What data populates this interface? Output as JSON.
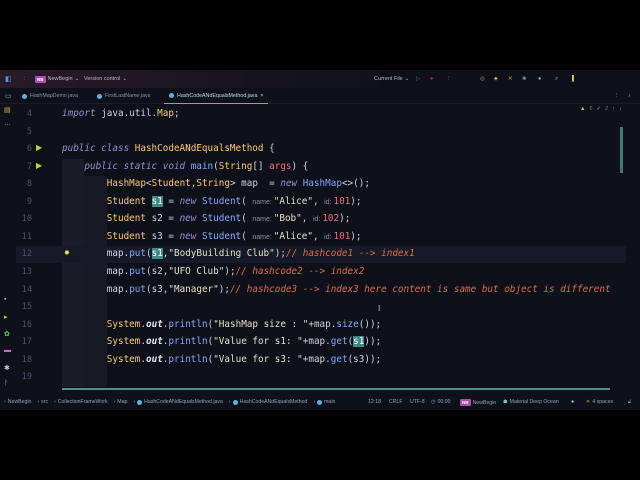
{
  "toolbar": {
    "project": "NewBegin",
    "project_badge": "NB",
    "vcs": "Version control",
    "run_config": "Current File"
  },
  "tabs": [
    {
      "label": "HashMapDemo.java"
    },
    {
      "label": "FirstLastName.java"
    },
    {
      "label": "HashCodeANdEqualsMethod.java",
      "close": "×"
    }
  ],
  "inspections": {
    "warnings": "6",
    "checks": "2"
  },
  "editor": {
    "lines": [
      {
        "n": "4",
        "tokens": [
          [
            "import ",
            "kw"
          ],
          [
            "java.util.",
            "plain"
          ],
          [
            "Map",
            "cls"
          ],
          [
            ";",
            "plain"
          ]
        ]
      },
      {
        "n": "5",
        "tokens": []
      },
      {
        "n": "6",
        "run": true,
        "tokens": [
          [
            "public class ",
            "kw"
          ],
          [
            "HashCodeANdEqualsMethod",
            "cls"
          ],
          [
            " {",
            "plain"
          ]
        ]
      },
      {
        "n": "7",
        "run": true,
        "indent": 1,
        "tokens": [
          [
            "public static void ",
            "kw"
          ],
          [
            "main",
            "fn"
          ],
          [
            "(",
            "plain"
          ],
          [
            "String",
            "cls"
          ],
          [
            "[] ",
            "plain"
          ],
          [
            "args",
            "num"
          ],
          [
            ") {",
            "plain"
          ]
        ]
      },
      {
        "n": "8",
        "indent": 2,
        "tokens": [
          [
            "HashMap",
            "cls"
          ],
          [
            "<",
            "plain"
          ],
          [
            "Student",
            "cls"
          ],
          [
            ",",
            "plain"
          ],
          [
            "String",
            "cls"
          ],
          [
            "> map  = ",
            "plain"
          ],
          [
            "new ",
            "kw"
          ],
          [
            "HashMap",
            "fn"
          ],
          [
            "<>();",
            "plain"
          ]
        ]
      },
      {
        "n": "9",
        "indent": 2,
        "tokens": [
          [
            "Student ",
            "cls"
          ],
          [
            "s1",
            "sel"
          ],
          [
            " = ",
            "plain"
          ],
          [
            "new ",
            "kw"
          ],
          [
            "Student",
            "fn"
          ],
          [
            "( ",
            "plain"
          ],
          [
            "name: ",
            "hint"
          ],
          [
            "\"Alice\"",
            "str"
          ],
          [
            ", ",
            "plain"
          ],
          [
            "id: ",
            "hint"
          ],
          [
            "101",
            "num"
          ],
          [
            ");",
            "plain"
          ]
        ]
      },
      {
        "n": "10",
        "indent": 2,
        "tokens": [
          [
            "Student ",
            "cls"
          ],
          [
            "s2",
            "plain"
          ],
          [
            " = ",
            "plain"
          ],
          [
            "new ",
            "kw"
          ],
          [
            "Student",
            "fn"
          ],
          [
            "( ",
            "plain"
          ],
          [
            "name: ",
            "hint"
          ],
          [
            "\"Bob\"",
            "str"
          ],
          [
            ", ",
            "plain"
          ],
          [
            "id: ",
            "hint"
          ],
          [
            "102",
            "num"
          ],
          [
            ");",
            "plain"
          ]
        ]
      },
      {
        "n": "11",
        "indent": 2,
        "tokens": [
          [
            "Student ",
            "cls"
          ],
          [
            "s3",
            "plain"
          ],
          [
            " = ",
            "plain"
          ],
          [
            "new ",
            "kw"
          ],
          [
            "Student",
            "fn"
          ],
          [
            "( ",
            "plain"
          ],
          [
            "name: ",
            "hint"
          ],
          [
            "\"Alice\"",
            "str"
          ],
          [
            ", ",
            "plain"
          ],
          [
            "id: ",
            "hint"
          ],
          [
            "101",
            "num"
          ],
          [
            ");",
            "plain"
          ]
        ]
      },
      {
        "n": "12",
        "current": true,
        "indent": 2,
        "tokens": [
          [
            "map.",
            "plain"
          ],
          [
            "put",
            "fn"
          ],
          [
            "(",
            "plain"
          ],
          [
            "s1",
            "sel"
          ],
          [
            ",",
            "plain"
          ],
          [
            "\"BodyBuilding Club\"",
            "str"
          ],
          [
            ");",
            "plain"
          ],
          [
            "// hashcode1 --> index1",
            "cm"
          ]
        ]
      },
      {
        "n": "13",
        "indent": 2,
        "tokens": [
          [
            "map.",
            "plain"
          ],
          [
            "put",
            "fn"
          ],
          [
            "(s2,",
            "plain"
          ],
          [
            "\"UFO Club\"",
            "str"
          ],
          [
            ");",
            "plain"
          ],
          [
            "// hashcode2 --> index2",
            "cm"
          ]
        ]
      },
      {
        "n": "14",
        "indent": 2,
        "tokens": [
          [
            "map.",
            "plain"
          ],
          [
            "put",
            "fn"
          ],
          [
            "(s3,",
            "plain"
          ],
          [
            "\"Manager\"",
            "str"
          ],
          [
            ");",
            "plain"
          ],
          [
            "// hashcode3 --> index3 here content is same but object is different",
            "cm"
          ]
        ]
      },
      {
        "n": "15",
        "tokens": []
      },
      {
        "n": "16",
        "indent": 2,
        "tokens": [
          [
            "System",
            "cls"
          ],
          [
            ".",
            "plain"
          ],
          [
            "out",
            "fld"
          ],
          [
            ".",
            "plain"
          ],
          [
            "println",
            "fn"
          ],
          [
            "(",
            "plain"
          ],
          [
            "\"HashMap size : \"",
            "str"
          ],
          [
            "+map.",
            "plain"
          ],
          [
            "size",
            "fn"
          ],
          [
            "());",
            "plain"
          ]
        ]
      },
      {
        "n": "17",
        "indent": 2,
        "tokens": [
          [
            "System",
            "cls"
          ],
          [
            ".",
            "plain"
          ],
          [
            "out",
            "fld"
          ],
          [
            ".",
            "plain"
          ],
          [
            "println",
            "fn"
          ],
          [
            "(",
            "plain"
          ],
          [
            "\"Value for s1: \"",
            "str"
          ],
          [
            "+map.",
            "plain"
          ],
          [
            "get",
            "fn"
          ],
          [
            "(",
            "plain"
          ],
          [
            "s1",
            "sel"
          ],
          [
            "));",
            "plain"
          ]
        ]
      },
      {
        "n": "18",
        "indent": 2,
        "tokens": [
          [
            "System",
            "cls"
          ],
          [
            ".",
            "plain"
          ],
          [
            "out",
            "fld"
          ],
          [
            ".",
            "plain"
          ],
          [
            "println",
            "fn"
          ],
          [
            "(",
            "plain"
          ],
          [
            "\"Value for s3: \"",
            "str"
          ],
          [
            "+map.",
            "plain"
          ],
          [
            "get",
            "fn"
          ],
          [
            "(s3));",
            "plain"
          ]
        ]
      },
      {
        "n": "19",
        "tokens": []
      }
    ]
  },
  "statusbar": {
    "breadcrumbs": [
      "NewBegin",
      "src",
      "CollectionFrameWork",
      "Map",
      "HashCodeANdEqualsMethod.java",
      "HashCodeANdEqualsMethod",
      "main"
    ],
    "position": "12:18",
    "line_sep": "CRLF",
    "encoding": "UTF-8",
    "timer": "00:00",
    "project_badge": "NB",
    "project": "NewBegin",
    "theme": "Material Deep Ocean",
    "indent": "4 spaces"
  }
}
